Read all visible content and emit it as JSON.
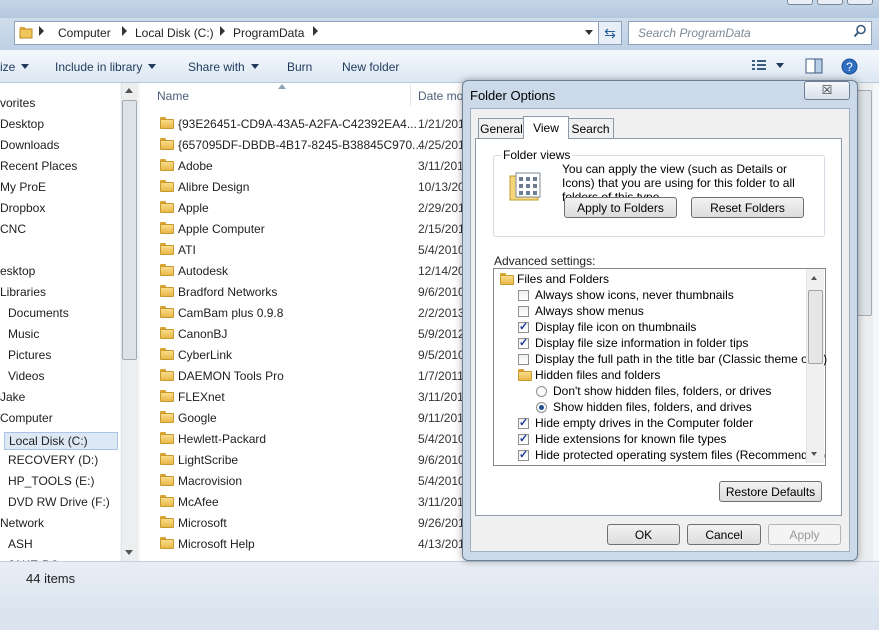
{
  "explorer": {
    "breadcrumb": [
      "Computer",
      "Local Disk (C:)",
      "ProgramData"
    ],
    "search_placeholder": "Search ProgramData",
    "toolbar": {
      "organize": "ize",
      "include_in_library": "Include in library",
      "share_with": "Share with",
      "burn": "Burn",
      "new_folder": "New folder"
    },
    "nav_items": [
      {
        "label": "vorites",
        "indent": 0
      },
      {
        "label": "Desktop",
        "indent": 0
      },
      {
        "label": "Downloads",
        "indent": 0
      },
      {
        "label": "Recent Places",
        "indent": 0
      },
      {
        "label": "My ProE",
        "indent": 0
      },
      {
        "label": "Dropbox",
        "indent": 0
      },
      {
        "label": "CNC",
        "indent": 0
      },
      {
        "label": "",
        "indent": 0
      },
      {
        "label": "esktop",
        "indent": 0
      },
      {
        "label": "Libraries",
        "indent": 0
      },
      {
        "label": "Documents",
        "indent": 1
      },
      {
        "label": "Music",
        "indent": 1
      },
      {
        "label": "Pictures",
        "indent": 1
      },
      {
        "label": "Videos",
        "indent": 1
      },
      {
        "label": "Jake",
        "indent": 0
      },
      {
        "label": "Computer",
        "indent": 0
      },
      {
        "label": "Local Disk (C:)",
        "indent": 1,
        "selected": true
      },
      {
        "label": "RECOVERY (D:)",
        "indent": 1
      },
      {
        "label": "HP_TOOLS (E:)",
        "indent": 1
      },
      {
        "label": "DVD RW Drive (F:)",
        "indent": 1
      },
      {
        "label": "Network",
        "indent": 0
      },
      {
        "label": "ASH",
        "indent": 1
      },
      {
        "label": "JAKE-PC",
        "indent": 1
      }
    ],
    "columns": {
      "name": "Name",
      "date": "Date mo"
    },
    "files": [
      {
        "name": "{93E26451-CD9A-43A5-A2FA-C42392EA4...",
        "date": "1/21/201"
      },
      {
        "name": "{657095DF-DBDB-4B17-8245-B38845C970...",
        "date": "4/25/201"
      },
      {
        "name": "Adobe",
        "date": "3/11/201"
      },
      {
        "name": "Alibre Design",
        "date": "10/13/20"
      },
      {
        "name": "Apple",
        "date": "2/29/201"
      },
      {
        "name": "Apple Computer",
        "date": "2/15/201"
      },
      {
        "name": "ATI",
        "date": "5/4/2010"
      },
      {
        "name": "Autodesk",
        "date": "12/14/20"
      },
      {
        "name": "Bradford Networks",
        "date": "9/6/2010"
      },
      {
        "name": "CamBam plus 0.9.8",
        "date": "2/2/2013"
      },
      {
        "name": "CanonBJ",
        "date": "5/9/2012"
      },
      {
        "name": "CyberLink",
        "date": "9/5/2010"
      },
      {
        "name": "DAEMON Tools Pro",
        "date": "1/7/2011"
      },
      {
        "name": "FLEXnet",
        "date": "3/11/201"
      },
      {
        "name": "Google",
        "date": "9/11/201"
      },
      {
        "name": "Hewlett-Packard",
        "date": "5/4/2010"
      },
      {
        "name": "LightScribe",
        "date": "9/6/2010"
      },
      {
        "name": "Macrovision",
        "date": "5/4/2010"
      },
      {
        "name": "McAfee",
        "date": "3/11/201"
      },
      {
        "name": "Microsoft",
        "date": "9/26/201"
      },
      {
        "name": "Microsoft Help",
        "date": "4/13/201"
      }
    ],
    "status": "44 items"
  },
  "dialog": {
    "title": "Folder Options",
    "close": "☒",
    "tabs": [
      "General",
      "View",
      "Search"
    ],
    "active_tab": "View",
    "folder_views": {
      "title": "Folder views",
      "description": "You can apply the view (such as Details or Icons) that you are using for this folder to all folders of this type.",
      "apply_button": "Apply to Folders",
      "reset_button": "Reset Folders"
    },
    "advanced_label": "Advanced settings:",
    "settings": [
      {
        "type": "folder",
        "label": "Files and Folders",
        "level": 0
      },
      {
        "type": "checkbox",
        "label": "Always show icons, never thumbnails",
        "checked": false,
        "level": 1
      },
      {
        "type": "checkbox",
        "label": "Always show menus",
        "checked": false,
        "level": 1
      },
      {
        "type": "checkbox",
        "label": "Display file icon on thumbnails",
        "checked": true,
        "level": 1
      },
      {
        "type": "checkbox",
        "label": "Display file size information in folder tips",
        "checked": true,
        "level": 1
      },
      {
        "type": "checkbox",
        "label": "Display the full path in the title bar (Classic theme only)",
        "checked": false,
        "level": 1
      },
      {
        "type": "folder",
        "label": "Hidden files and folders",
        "level": 1
      },
      {
        "type": "radio",
        "label": "Don't show hidden files, folders, or drives",
        "checked": false,
        "level": 2
      },
      {
        "type": "radio",
        "label": "Show hidden files, folders, and drives",
        "checked": true,
        "level": 2
      },
      {
        "type": "checkbox",
        "label": "Hide empty drives in the Computer folder",
        "checked": true,
        "level": 1
      },
      {
        "type": "checkbox",
        "label": "Hide extensions for known file types",
        "checked": true,
        "level": 1
      },
      {
        "type": "checkbox",
        "label": "Hide protected operating system files (Recommended)",
        "checked": true,
        "level": 1
      }
    ],
    "restore_defaults": "Restore Defaults",
    "ok": "OK",
    "cancel": "Cancel",
    "apply": "Apply"
  }
}
